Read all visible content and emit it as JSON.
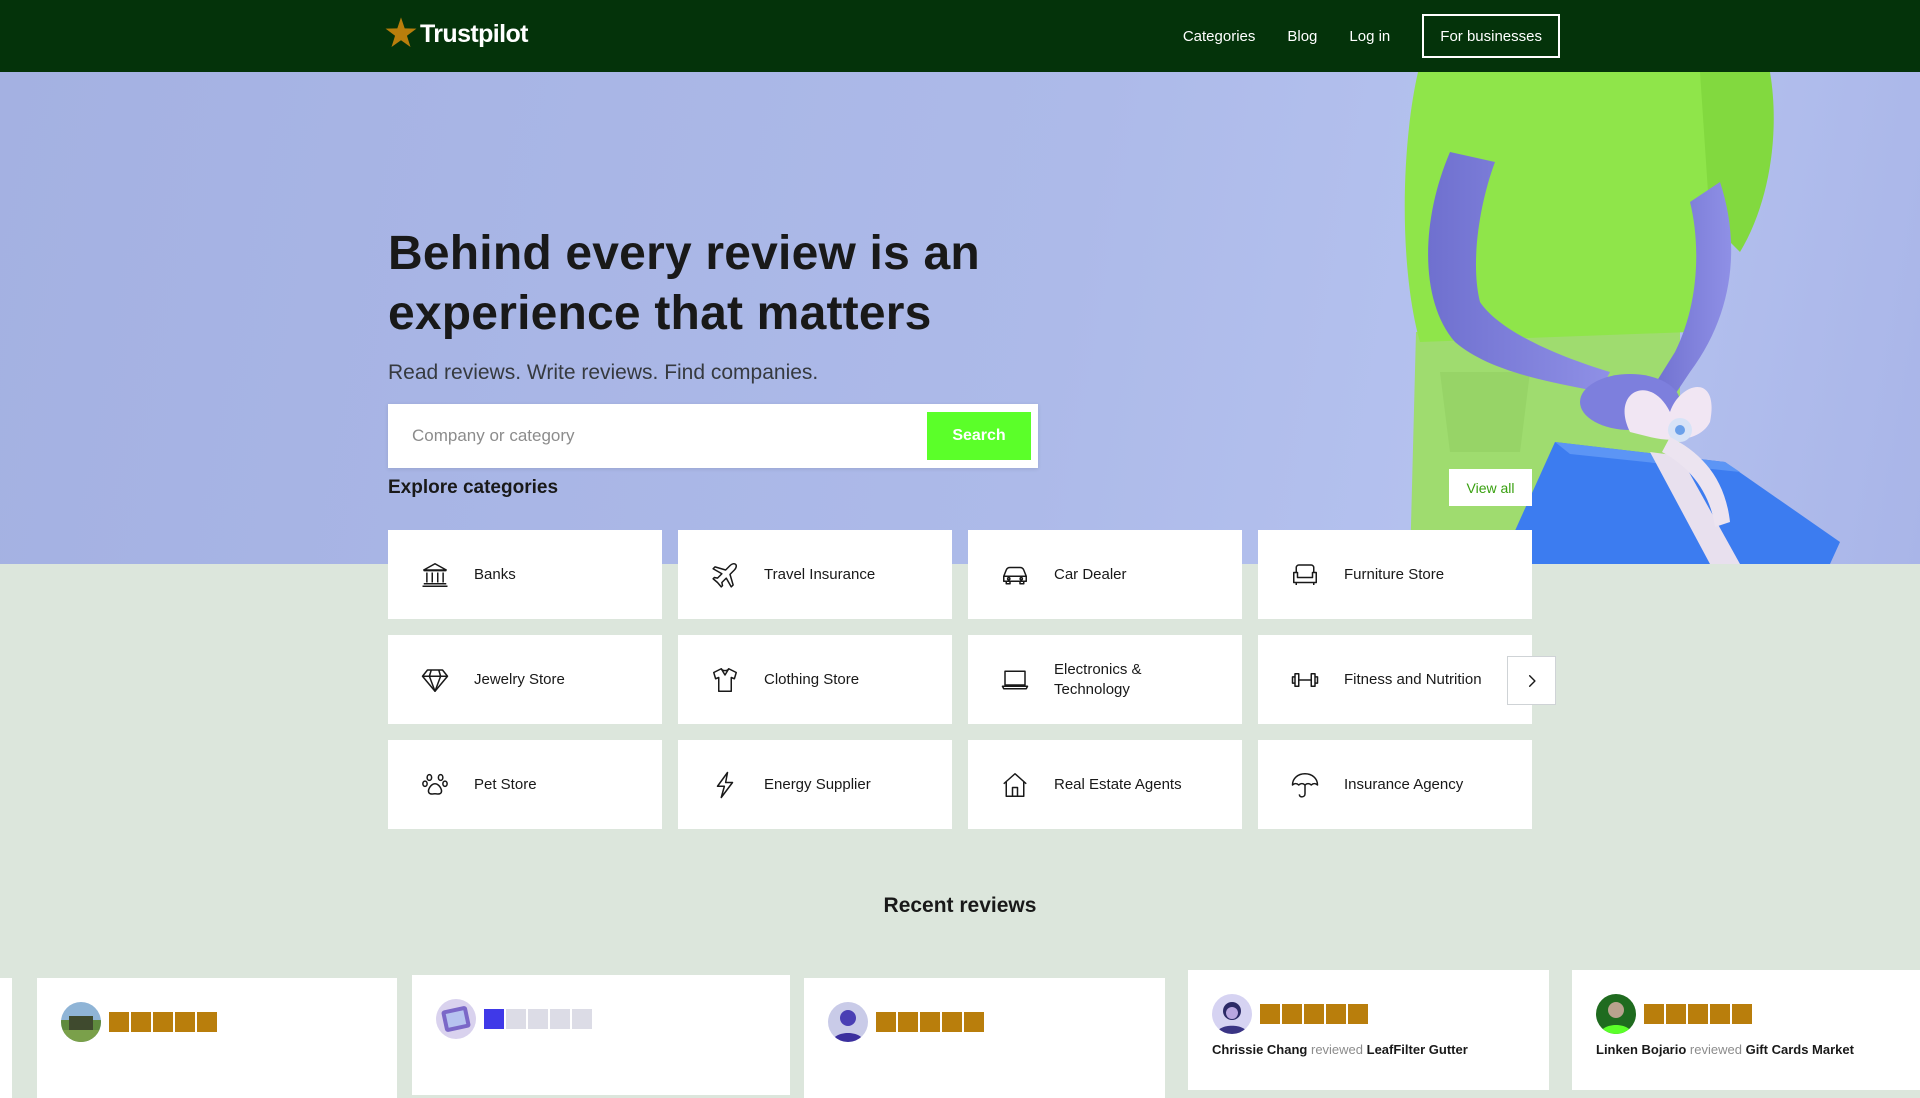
{
  "nav": {
    "logo_text": "Trustpilot",
    "links": [
      {
        "label": "Categories"
      },
      {
        "label": "Blog"
      },
      {
        "label": "Log in"
      }
    ],
    "business_button": "For businesses"
  },
  "hero": {
    "title": "Behind every review is an experience that matters",
    "subtitle": "Read reviews. Write reviews. Find companies.",
    "search": {
      "placeholder": "Company or category",
      "value": "",
      "button_label": "Search"
    }
  },
  "categories": {
    "title": "Explore categories",
    "view_all_label": "View all",
    "items": [
      {
        "label": "Banks",
        "icon": "bank-icon"
      },
      {
        "label": "Travel Insurance",
        "icon": "airplane-icon"
      },
      {
        "label": "Car Dealer",
        "icon": "car-icon"
      },
      {
        "label": "Furniture Store",
        "icon": "sofa-icon"
      },
      {
        "label": "Jewelry Store",
        "icon": "diamond-icon"
      },
      {
        "label": "Clothing Store",
        "icon": "shirt-icon"
      },
      {
        "label": "Electronics & Technology",
        "icon": "laptop-icon"
      },
      {
        "label": "Fitness and Nutrition",
        "icon": "dumbbell-icon"
      },
      {
        "label": "Pet Store",
        "icon": "paw-icon"
      },
      {
        "label": "Energy Supplier",
        "icon": "lightning-icon"
      },
      {
        "label": "Real Estate Agents",
        "icon": "house-icon"
      },
      {
        "label": "Insurance Agency",
        "icon": "umbrella-icon"
      }
    ]
  },
  "reviews": {
    "title": "Recent reviews",
    "reviewed_word": "reviewed",
    "items": [
      {
        "rating": 5,
        "reviewer": "",
        "company": ""
      },
      {
        "rating": 1,
        "reviewer": "",
        "company": ""
      },
      {
        "rating": 5,
        "reviewer": "",
        "company": ""
      },
      {
        "rating": 5,
        "reviewer": "Chrissie Chang",
        "company": "LeafFilter Gutter"
      },
      {
        "rating": 5,
        "reviewer": "Linken Bojario",
        "company": "Gift Cards Market"
      }
    ]
  },
  "colors": {
    "nav_bg": "#04330a",
    "hero_bg": "#adbae9",
    "page_bg": "#dce6dc",
    "search_button": "#5bff29",
    "view_all_text": "#38a00f",
    "star_five": "#b97e0c",
    "star_one": "#3f39e8",
    "star_empty": "#dcdce6"
  }
}
